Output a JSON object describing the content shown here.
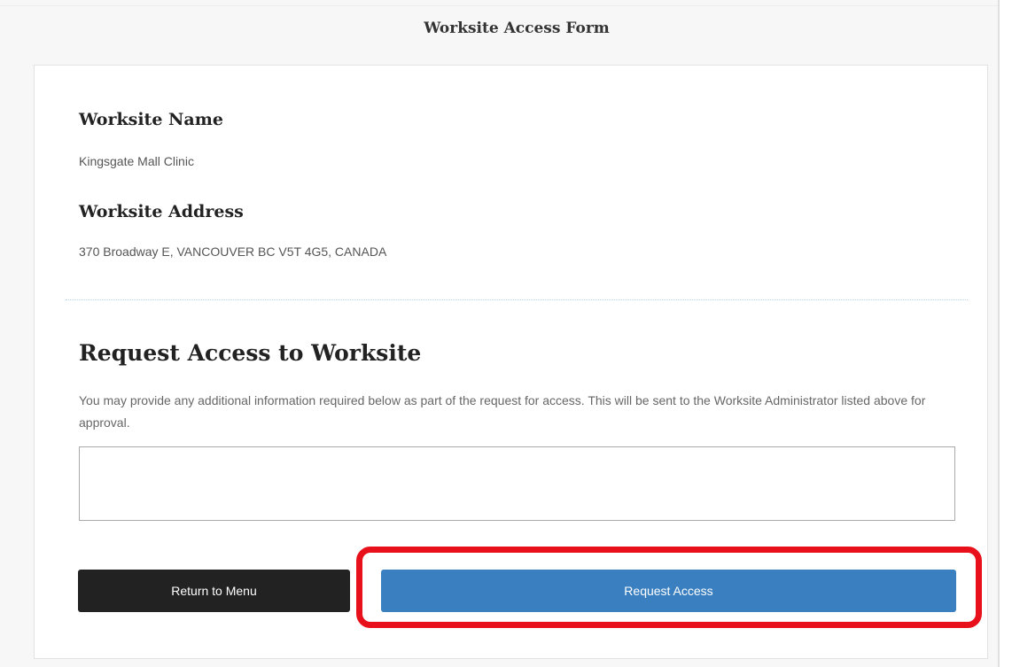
{
  "page": {
    "title": "Worksite Access Form"
  },
  "worksite": {
    "name_label": "Worksite Name",
    "name_value": "Kingsgate Mall Clinic",
    "address_label": "Worksite Address",
    "address_value": "370 Broadway E, VANCOUVER BC V5T 4G5, CANADA"
  },
  "request": {
    "title": "Request Access to Worksite",
    "description": "You may provide any additional information required below as part of the request for access. This will be sent to the Worksite Administrator listed above for approval.",
    "textarea_value": ""
  },
  "buttons": {
    "return_label": "Return to Menu",
    "request_label": "Request Access"
  },
  "colors": {
    "return_button": "#222222",
    "request_button": "#3a7fbf",
    "highlight": "#e8111b"
  }
}
